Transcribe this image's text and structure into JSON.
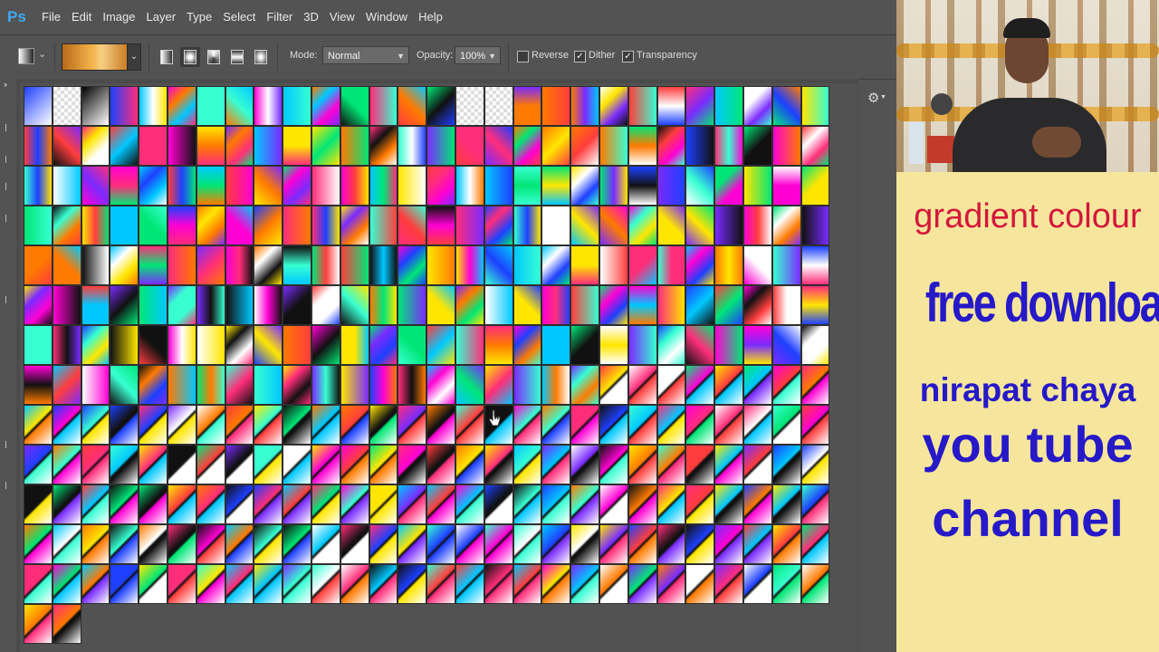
{
  "app": {
    "logo": "Ps"
  },
  "menu": [
    "File",
    "Edit",
    "Image",
    "Layer",
    "Type",
    "Select",
    "Filter",
    "3D",
    "View",
    "Window",
    "Help"
  ],
  "options_bar": {
    "mode_label": "Mode:",
    "mode_value": "Normal",
    "opacity_label": "Opacity:",
    "opacity_value": "100%",
    "reverse_label": "Reverse",
    "reverse_checked": false,
    "dither_label": "Dither",
    "dither_checked": true,
    "transparency_label": "Transparency",
    "transparency_checked": true,
    "gradient_types": [
      "linear",
      "radial",
      "angle",
      "reflected",
      "diamond"
    ],
    "active_gradient_type": "radial"
  },
  "gradient_presets": {
    "columns": 28,
    "full_rows": 13,
    "last_row_count": 2,
    "palette": [
      "#ff2d7a",
      "#ffe600",
      "#00c8ff",
      "#7a2bff",
      "#00e676",
      "#ff7a00",
      "#ff00d4",
      "#1e40ff",
      "#ffffff",
      "#111111",
      "#ff3d3d",
      "#37ffd2"
    ]
  },
  "promo": {
    "line1": "gradient colour",
    "line2": "free download",
    "line3": "nirapat chaya",
    "line4": "you tube",
    "line5": "channel",
    "color_line1": "#d3173a",
    "color_main": "#2619c8",
    "background": "#f6e69d"
  }
}
